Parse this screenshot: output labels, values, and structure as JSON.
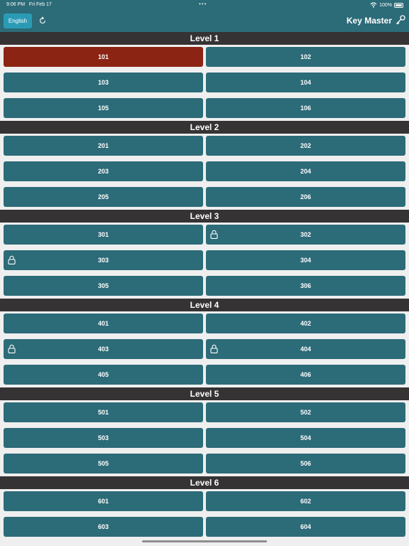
{
  "status_bar": {
    "time": "9:06 PM",
    "date": "Fri Feb 17",
    "battery": "100%"
  },
  "header": {
    "language_label": "English",
    "title": "Key Master"
  },
  "levels": [
    {
      "label": "Level 1",
      "keys": [
        {
          "label": "101",
          "locked": false,
          "selected": true
        },
        {
          "label": "102",
          "locked": false
        },
        {
          "label": "103",
          "locked": false
        },
        {
          "label": "104",
          "locked": false
        },
        {
          "label": "105",
          "locked": false
        },
        {
          "label": "106",
          "locked": false
        }
      ]
    },
    {
      "label": "Level 2",
      "keys": [
        {
          "label": "201",
          "locked": false
        },
        {
          "label": "202",
          "locked": false
        },
        {
          "label": "203",
          "locked": false
        },
        {
          "label": "204",
          "locked": false
        },
        {
          "label": "205",
          "locked": false
        },
        {
          "label": "206",
          "locked": false
        }
      ]
    },
    {
      "label": "Level 3",
      "keys": [
        {
          "label": "301",
          "locked": false
        },
        {
          "label": "302",
          "locked": true
        },
        {
          "label": "303",
          "locked": true
        },
        {
          "label": "304",
          "locked": false
        },
        {
          "label": "305",
          "locked": false
        },
        {
          "label": "306",
          "locked": false
        }
      ]
    },
    {
      "label": "Level 4",
      "keys": [
        {
          "label": "401",
          "locked": false
        },
        {
          "label": "402",
          "locked": false
        },
        {
          "label": "403",
          "locked": true
        },
        {
          "label": "404",
          "locked": true
        },
        {
          "label": "405",
          "locked": false
        },
        {
          "label": "406",
          "locked": false
        }
      ]
    },
    {
      "label": "Level 5",
      "keys": [
        {
          "label": "501",
          "locked": false
        },
        {
          "label": "502",
          "locked": false
        },
        {
          "label": "503",
          "locked": false
        },
        {
          "label": "504",
          "locked": false
        },
        {
          "label": "505",
          "locked": false
        },
        {
          "label": "506",
          "locked": false
        }
      ]
    },
    {
      "label": "Level 6",
      "keys": [
        {
          "label": "601",
          "locked": false
        },
        {
          "label": "602",
          "locked": false
        },
        {
          "label": "603",
          "locked": false
        },
        {
          "label": "604",
          "locked": false
        }
      ]
    }
  ],
  "colors": {
    "button": "#2c6b78",
    "selected": "#8b2413",
    "level_header": "#363334",
    "language_button": "#2b9bb5"
  }
}
